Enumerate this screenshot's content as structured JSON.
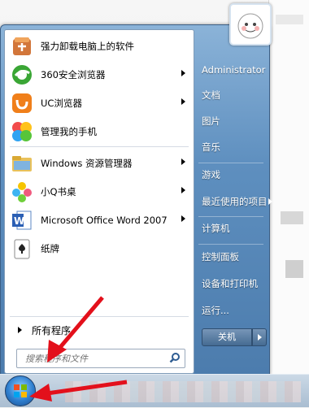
{
  "programs": [
    {
      "label": "强力卸载电脑上的软件",
      "icon": "uninstaller-icon",
      "has_submenu": false
    },
    {
      "label": "360安全浏览器",
      "icon": "360-browser-icon",
      "has_submenu": true
    },
    {
      "label": "UC浏览器",
      "icon": "uc-browser-icon",
      "has_submenu": true
    },
    {
      "label": "管理我的手机",
      "icon": "phone-manager-icon",
      "has_submenu": false
    },
    {
      "label": "Windows 资源管理器",
      "icon": "explorer-folder-icon",
      "has_submenu": true
    },
    {
      "label": "小Q书桌",
      "icon": "xiaoq-desk-icon",
      "has_submenu": true
    },
    {
      "label": "Microsoft Office Word 2007",
      "icon": "word-icon",
      "has_submenu": true
    },
    {
      "label": "纸牌",
      "icon": "solitaire-icon",
      "has_submenu": false
    }
  ],
  "all_programs_label": "所有程序",
  "search": {
    "placeholder": "搜索程序和文件"
  },
  "right_links": [
    {
      "label": "Administrator",
      "has_submenu": false
    },
    {
      "label": "文档",
      "has_submenu": false
    },
    {
      "label": "图片",
      "has_submenu": false
    },
    {
      "label": "音乐",
      "has_submenu": false
    },
    {
      "label": "游戏",
      "has_submenu": false
    },
    {
      "label": "最近使用的项目",
      "has_submenu": true
    },
    {
      "label": "计算机",
      "has_submenu": false
    },
    {
      "label": "控制面板",
      "has_submenu": false
    },
    {
      "label": "设备和打印机",
      "has_submenu": false
    },
    {
      "label": "运行...",
      "has_submenu": false
    }
  ],
  "shutdown_label": "关机",
  "colors": {
    "accent_arrow": "#e3101b",
    "menu_glass": "#5e8fbf"
  }
}
